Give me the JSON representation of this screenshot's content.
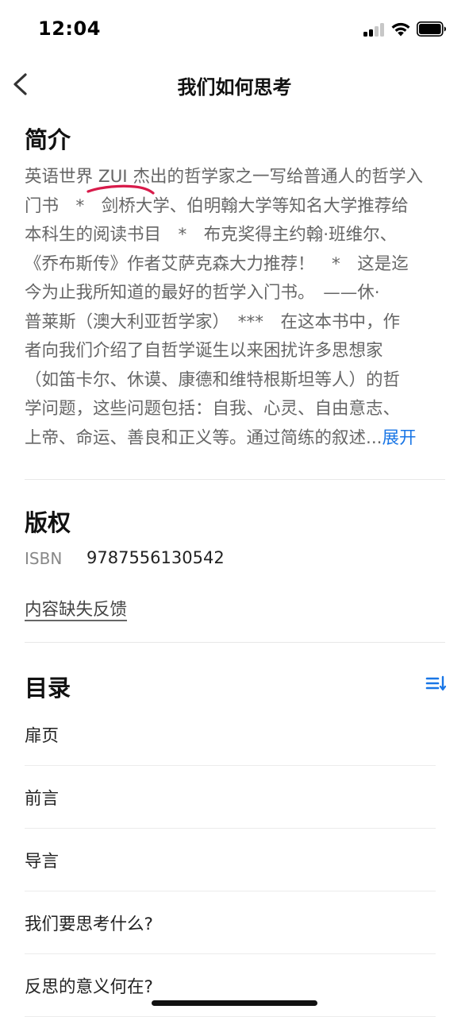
{
  "status_bar": {
    "time": "12:04"
  },
  "nav": {
    "title": "我们如何思考",
    "back_icon": "chevron-left-icon"
  },
  "intro": {
    "heading": "简介",
    "lines": [
      "英语世界 ZUI 杰出的哲学家之一写给普通人的哲学入",
      "门书　*　剑桥大学、伯明翰大学等知名大学推荐给",
      "本科生的阅读书目　*　布克奖得主约翰·班维尔、",
      "《乔布斯传》作者艾萨克森大力推荐！　*　这是迄",
      "今为止我所知道的最好的哲学入门书。　——休·",
      "普莱斯（澳大利亚哲学家）　***　在这本书中，作",
      "者向我们介绍了自哲学诞生以来困扰许多思想家",
      "（如笛卡尔、休谟、康德和维特根斯坦等人）的哲",
      "学问题，这些问题包括：自我、心灵、自由意志、",
      "上帝、命运、善良和正义等。通过简练的叙述..."
    ],
    "expand_label": "展开",
    "highlight_color": "#d81b4a"
  },
  "copyright": {
    "heading": "版权",
    "isbn_label": "ISBN",
    "isbn_value": "9787556130542",
    "feedback_label": "内容缺失反馈"
  },
  "toc": {
    "heading": "目录",
    "sort_icon": "sort-list-icon",
    "items": [
      "扉页",
      "前言",
      "导言",
      "我们要思考什么?",
      "反思的意义何在?"
    ]
  },
  "colors": {
    "accent": "#1976e6",
    "text_primary": "#111111",
    "text_secondary": "#666666"
  }
}
